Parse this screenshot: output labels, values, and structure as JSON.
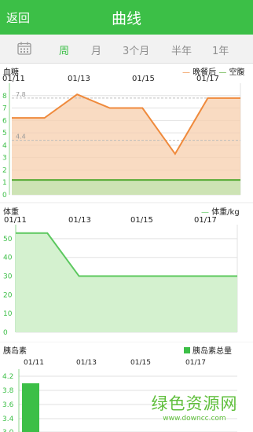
{
  "header": {
    "back_label": "返回",
    "title": "曲线"
  },
  "tabs": {
    "items": [
      "周",
      "月",
      "3个月",
      "半年",
      "1年"
    ],
    "active": 0
  },
  "icons": {
    "calendar": "calendar-icon"
  },
  "colors": {
    "brand": "#3cbf47",
    "glucose_line": "#ef8a3c",
    "weight_line": "#5bc85e",
    "fasting_line": "#55aa33"
  },
  "chart_data": [
    {
      "type": "line",
      "title": "血糖",
      "x_labels": [
        "01/11",
        "01/13",
        "01/15",
        "01/17"
      ],
      "legend": {
        "post_dinner": "晚餐后",
        "fasting": "空腹"
      },
      "ylim": [
        0,
        9
      ],
      "yticks": [
        "0",
        "1",
        "2",
        "3",
        "4",
        "5",
        "6",
        "7",
        "8"
      ],
      "reference_lines": [
        {
          "value": 7.8,
          "label": "7.8"
        },
        {
          "value": 4.4,
          "label": "4.4"
        }
      ],
      "series": [
        {
          "name": "晚餐后",
          "x": [
            0,
            1,
            2,
            3,
            4,
            5,
            6,
            7
          ],
          "values": [
            6.2,
            6.2,
            8.1,
            7.0,
            7.0,
            3.3,
            7.8,
            7.8
          ]
        },
        {
          "name": "空腹",
          "x": [
            0,
            7
          ],
          "values": [
            1.2,
            1.2
          ]
        }
      ]
    },
    {
      "type": "line",
      "title": "体重",
      "x_labels": [
        "01/11",
        "01/13",
        "01/15",
        "01/17"
      ],
      "legend": {
        "weight": "体重/kg"
      },
      "ylim": [
        0,
        55
      ],
      "yticks": [
        "0",
        "10",
        "20",
        "30",
        "40",
        "50"
      ],
      "series": [
        {
          "name": "体重/kg",
          "x": [
            0,
            1,
            2,
            3,
            4,
            5,
            6,
            7
          ],
          "values": [
            53,
            53,
            30,
            30,
            30,
            30,
            30,
            30
          ]
        }
      ]
    },
    {
      "type": "bar",
      "title": "胰岛素",
      "x_labels": [
        "01/11",
        "01/13",
        "01/15",
        "01/17"
      ],
      "legend": {
        "total": "胰岛素总量"
      },
      "yticks": [
        "3.0",
        "3.4",
        "3.6",
        "3.8",
        "4.2"
      ],
      "series": [
        {
          "name": "胰岛素总量",
          "x": [
            0
          ],
          "values": [
            4.0
          ]
        }
      ]
    }
  ],
  "watermark": {
    "main": "绿色资源网",
    "url": "www.downcc.com"
  }
}
